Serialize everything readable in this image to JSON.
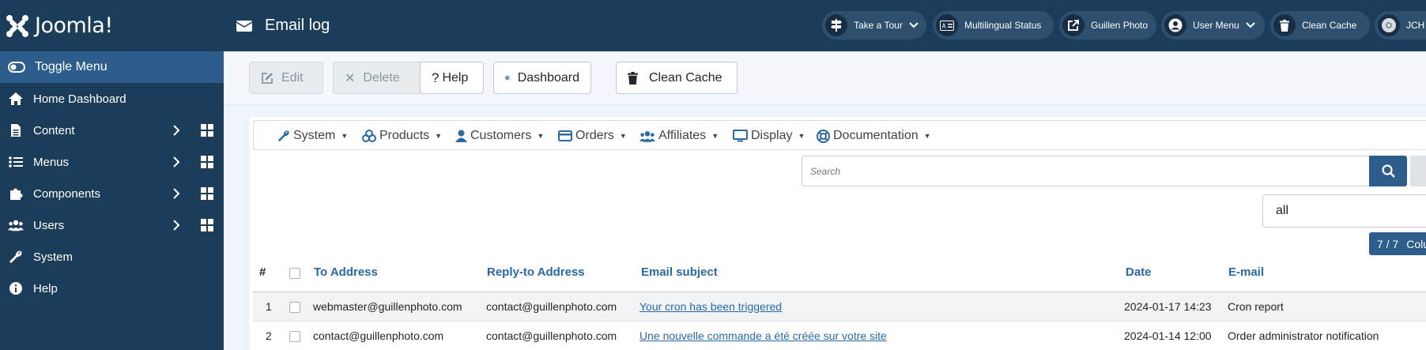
{
  "brand": {
    "name": "Joomla!"
  },
  "sidebar": {
    "toggle_label": "Toggle Menu",
    "items": [
      {
        "label": "Home Dashboard",
        "icon": "home-icon"
      },
      {
        "label": "Content",
        "icon": "file-icon"
      },
      {
        "label": "Menus",
        "icon": "list-icon"
      },
      {
        "label": "Components",
        "icon": "puzzle-icon"
      },
      {
        "label": "Users",
        "icon": "users-icon"
      },
      {
        "label": "System",
        "icon": "wrench-icon"
      },
      {
        "label": "Help",
        "icon": "info-icon"
      }
    ]
  },
  "header": {
    "title": "Email log",
    "pills": [
      {
        "label": "Take a Tour",
        "icon": "signpost-icon"
      },
      {
        "label": "Multilingual Status",
        "icon": "language-card-icon"
      },
      {
        "label": "Guillen Photo",
        "icon": "external-link-icon"
      },
      {
        "label": "User Menu",
        "icon": "user-circle-icon"
      },
      {
        "label": "Clean Cache",
        "icon": "trash-icon"
      },
      {
        "label": "JCH O",
        "icon": "disc-icon"
      }
    ]
  },
  "toolbar": {
    "edit_label": "Edit",
    "delete_label": "Delete",
    "help_label": "Help",
    "dashboard_label": "Dashboard",
    "clean_cache_label": "Clean Cache"
  },
  "hikashop_menu": [
    {
      "label": "System",
      "icon": "wrench-icon"
    },
    {
      "label": "Products",
      "icon": "cubes-icon"
    },
    {
      "label": "Customers",
      "icon": "user-icon"
    },
    {
      "label": "Orders",
      "icon": "credit-card-icon"
    },
    {
      "label": "Affiliates",
      "icon": "users-icon"
    },
    {
      "label": "Display",
      "icon": "monitor-icon"
    },
    {
      "label": "Documentation",
      "icon": "life-ring-icon"
    }
  ],
  "filters": {
    "search_placeholder": "Search",
    "select_value": "all",
    "columns_count": "7 / 7",
    "columns_label": "Colu"
  },
  "table": {
    "headers": [
      "#",
      "To Address",
      "Reply-to Address",
      "Email subject",
      "Date",
      "E-mail"
    ],
    "rows": [
      {
        "num": "1",
        "to": "webmaster@guillenphoto.com",
        "reply": "contact@guillenphoto.com",
        "subject": "Your cron has been triggered",
        "date": "2024-01-17 14:23",
        "email": "Cron report"
      },
      {
        "num": "2",
        "to": "contact@guillenphoto.com",
        "reply": "contact@guillenphoto.com",
        "subject": "Une nouvelle commande a été créée sur votre site",
        "date": "2024-01-14 12:00",
        "email": "Order administrator notification"
      }
    ]
  },
  "colors": {
    "sidebar": "#1c3d5a",
    "accent": "#2d5d8b",
    "link": "#2a69a2"
  }
}
